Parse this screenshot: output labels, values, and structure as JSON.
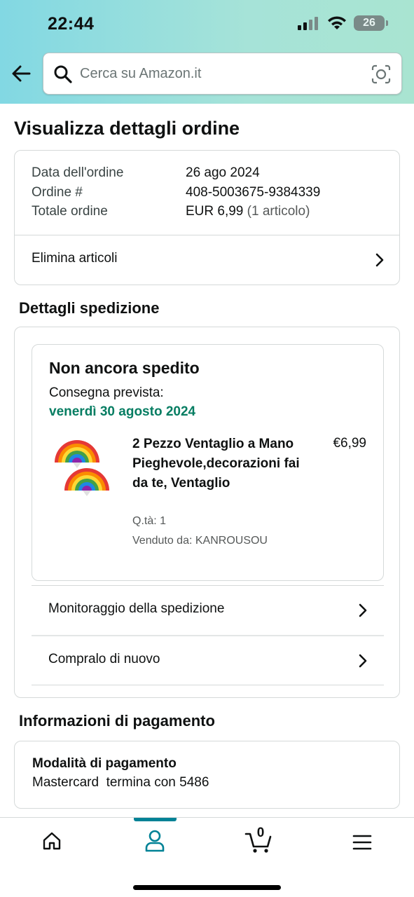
{
  "status_bar": {
    "time": "22:44",
    "battery": "26"
  },
  "search": {
    "placeholder": "Cerca su Amazon.it"
  },
  "page_title": "Visualizza dettagli ordine",
  "order_summary": {
    "rows": [
      {
        "label": "Data dell'ordine",
        "value": "26 ago 2024"
      },
      {
        "label": "Ordine #",
        "value": "408-5003675-9384339"
      },
      {
        "label": "Totale ordine",
        "value": "EUR 6,99",
        "note": "(1 articolo)"
      }
    ],
    "delete_items_label": "Elimina articoli"
  },
  "shipping": {
    "section_title": "Dettagli spedizione",
    "status": "Non ancora spedito",
    "delivery_label": "Consegna prevista:",
    "delivery_date": "venerdì 30 agosto 2024",
    "delivery_date_color": "#067d62",
    "product": {
      "title": "2 Pezzo Ventaglio a Mano Pieghevole,decorazioni fai da te, Ventaglio",
      "price": "€6,99",
      "qty": "Q.tà: 1",
      "seller": "Venduto da: KANROUSOU",
      "image_icon": "rainbow-fan-image"
    },
    "links": [
      {
        "label": "Monitoraggio della spedizione"
      },
      {
        "label": "Compralo di nuovo"
      }
    ]
  },
  "payment": {
    "section_title": "Informazioni di pagamento",
    "method_label": "Modalità di pagamento",
    "method_value": "Mastercard  termina con 5486"
  },
  "bottom_nav": {
    "items": [
      "home-icon",
      "account-icon",
      "cart-icon",
      "menu-icon"
    ],
    "active": "account-icon",
    "cart_count": "0",
    "accent_color": "#008296"
  }
}
